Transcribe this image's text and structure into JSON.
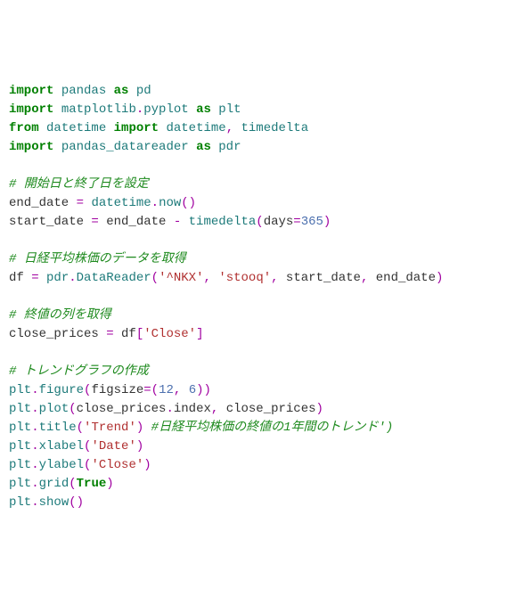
{
  "lines": [
    [
      [
        "kw",
        "import"
      ],
      [
        "id",
        " "
      ],
      [
        "mod",
        "pandas"
      ],
      [
        "id",
        " "
      ],
      [
        "kw",
        "as"
      ],
      [
        "id",
        " "
      ],
      [
        "mod",
        "pd"
      ]
    ],
    [
      [
        "kw",
        "import"
      ],
      [
        "id",
        " "
      ],
      [
        "mod",
        "matplotlib"
      ],
      [
        "op",
        "."
      ],
      [
        "mod",
        "pyplot"
      ],
      [
        "id",
        " "
      ],
      [
        "kw",
        "as"
      ],
      [
        "id",
        " "
      ],
      [
        "mod",
        "plt"
      ]
    ],
    [
      [
        "kw",
        "from"
      ],
      [
        "id",
        " "
      ],
      [
        "mod",
        "datetime"
      ],
      [
        "id",
        " "
      ],
      [
        "kw",
        "import"
      ],
      [
        "id",
        " "
      ],
      [
        "mod",
        "datetime"
      ],
      [
        "op",
        ","
      ],
      [
        "id",
        " "
      ],
      [
        "mod",
        "timedelta"
      ]
    ],
    [
      [
        "kw",
        "import"
      ],
      [
        "id",
        " "
      ],
      [
        "mod",
        "pandas_datareader"
      ],
      [
        "id",
        " "
      ],
      [
        "kw",
        "as"
      ],
      [
        "id",
        " "
      ],
      [
        "mod",
        "pdr"
      ]
    ],
    [],
    [
      [
        "cmt",
        "# 開始日と終了日を設定"
      ]
    ],
    [
      [
        "id",
        "end_date "
      ],
      [
        "op",
        "="
      ],
      [
        "id",
        " "
      ],
      [
        "mod",
        "datetime"
      ],
      [
        "op",
        "."
      ],
      [
        "mod",
        "now"
      ],
      [
        "op",
        "()"
      ]
    ],
    [
      [
        "id",
        "start_date "
      ],
      [
        "op",
        "="
      ],
      [
        "id",
        " end_date "
      ],
      [
        "op",
        "-"
      ],
      [
        "id",
        " "
      ],
      [
        "mod",
        "timedelta"
      ],
      [
        "op",
        "("
      ],
      [
        "id",
        "days"
      ],
      [
        "op",
        "="
      ],
      [
        "num",
        "365"
      ],
      [
        "op",
        ")"
      ]
    ],
    [],
    [
      [
        "cmt",
        "# 日経平均株価のデータを取得"
      ]
    ],
    [
      [
        "id",
        "df "
      ],
      [
        "op",
        "="
      ],
      [
        "id",
        " "
      ],
      [
        "mod",
        "pdr"
      ],
      [
        "op",
        "."
      ],
      [
        "mod",
        "DataReader"
      ],
      [
        "op",
        "("
      ],
      [
        "str",
        "'^NKX'"
      ],
      [
        "op",
        ","
      ],
      [
        "id",
        " "
      ],
      [
        "str",
        "'stooq'"
      ],
      [
        "op",
        ","
      ],
      [
        "id",
        " start_date"
      ],
      [
        "op",
        ","
      ],
      [
        "id",
        " end_date"
      ],
      [
        "op",
        ")"
      ]
    ],
    [],
    [
      [
        "cmt",
        "# 終値の列を取得"
      ]
    ],
    [
      [
        "id",
        "close_prices "
      ],
      [
        "op",
        "="
      ],
      [
        "id",
        " df"
      ],
      [
        "op",
        "["
      ],
      [
        "str",
        "'Close'"
      ],
      [
        "op",
        "]"
      ]
    ],
    [],
    [
      [
        "cmt",
        "# トレンドグラフの作成"
      ]
    ],
    [
      [
        "mod",
        "plt"
      ],
      [
        "op",
        "."
      ],
      [
        "mod",
        "figure"
      ],
      [
        "op",
        "("
      ],
      [
        "id",
        "figsize"
      ],
      [
        "op",
        "=("
      ],
      [
        "num",
        "12"
      ],
      [
        "op",
        ","
      ],
      [
        "id",
        " "
      ],
      [
        "num",
        "6"
      ],
      [
        "op",
        "))"
      ]
    ],
    [
      [
        "mod",
        "plt"
      ],
      [
        "op",
        "."
      ],
      [
        "mod",
        "plot"
      ],
      [
        "op",
        "("
      ],
      [
        "id",
        "close_prices"
      ],
      [
        "op",
        "."
      ],
      [
        "id",
        "index"
      ],
      [
        "op",
        ","
      ],
      [
        "id",
        " close_prices"
      ],
      [
        "op",
        ")"
      ]
    ],
    [
      [
        "mod",
        "plt"
      ],
      [
        "op",
        "."
      ],
      [
        "mod",
        "title"
      ],
      [
        "op",
        "("
      ],
      [
        "str",
        "'Trend'"
      ],
      [
        "op",
        ")"
      ],
      [
        "id",
        " "
      ],
      [
        "cmt",
        "#日経平均株価の終値の1年間のトレンド')"
      ]
    ],
    [
      [
        "mod",
        "plt"
      ],
      [
        "op",
        "."
      ],
      [
        "mod",
        "xlabel"
      ],
      [
        "op",
        "("
      ],
      [
        "str",
        "'Date'"
      ],
      [
        "op",
        ")"
      ]
    ],
    [
      [
        "mod",
        "plt"
      ],
      [
        "op",
        "."
      ],
      [
        "mod",
        "ylabel"
      ],
      [
        "op",
        "("
      ],
      [
        "str",
        "'Close'"
      ],
      [
        "op",
        ")"
      ]
    ],
    [
      [
        "mod",
        "plt"
      ],
      [
        "op",
        "."
      ],
      [
        "mod",
        "grid"
      ],
      [
        "op",
        "("
      ],
      [
        "bool",
        "True"
      ],
      [
        "op",
        ")"
      ]
    ],
    [
      [
        "mod",
        "plt"
      ],
      [
        "op",
        "."
      ],
      [
        "mod",
        "show"
      ],
      [
        "op",
        "()"
      ]
    ]
  ]
}
